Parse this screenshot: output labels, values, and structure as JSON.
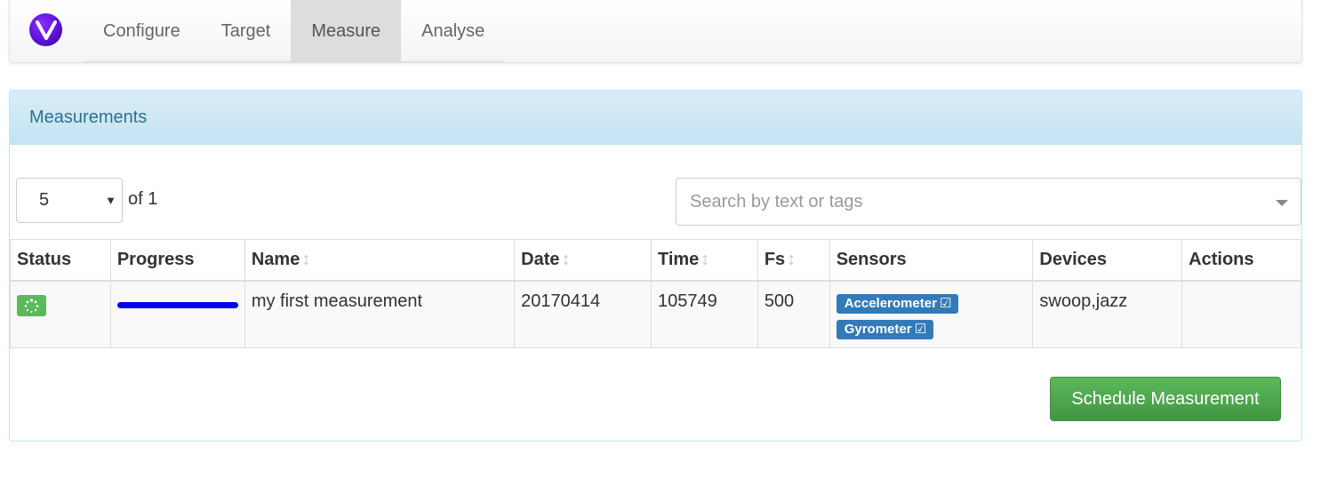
{
  "nav": {
    "logo_letter": "V",
    "tabs": [
      {
        "label": "Configure",
        "active": false
      },
      {
        "label": "Target",
        "active": false
      },
      {
        "label": "Measure",
        "active": true
      },
      {
        "label": "Analyse",
        "active": false
      }
    ]
  },
  "panel": {
    "title": "Measurements",
    "page_size": "5",
    "page_count_label": "of 1",
    "search_placeholder": "Search by text or tags"
  },
  "table": {
    "headers": [
      "Status",
      "Progress",
      "Name",
      "Date",
      "Time",
      "Fs",
      "Sensors",
      "Devices",
      "Actions"
    ],
    "sortable": [
      false,
      false,
      true,
      true,
      true,
      true,
      false,
      false,
      false
    ],
    "rows": [
      {
        "status_icon": "spinner-icon",
        "progress": 1.0,
        "name": "my first measurement",
        "date": "20170414",
        "time": "105749",
        "fs": "500",
        "sensors": [
          "Accelerometer",
          "Gyrometer"
        ],
        "devices": "swoop,jazz",
        "actions": ""
      }
    ]
  },
  "actions": {
    "schedule_label": "Schedule Measurement"
  },
  "colors": {
    "accent_blue": "#337ab7",
    "success_green": "#5cb85c",
    "progress_blue": "#0000ee",
    "panel_heading": "#d9edf7"
  }
}
